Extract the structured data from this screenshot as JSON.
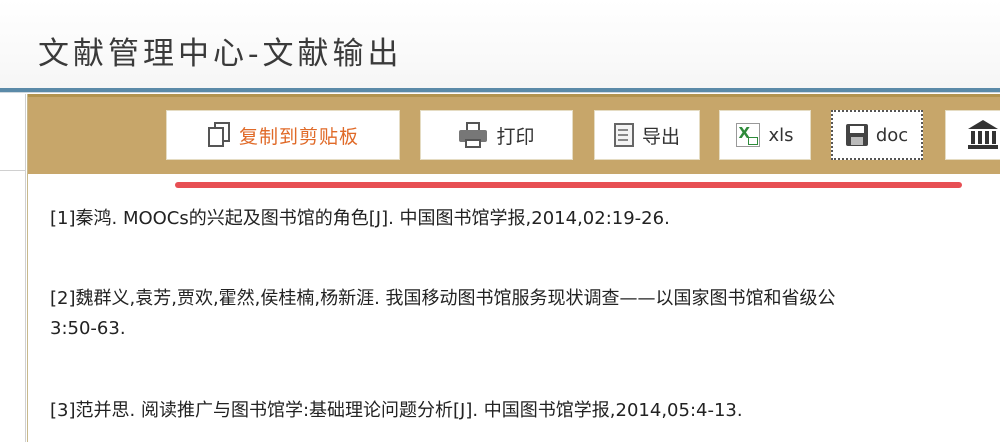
{
  "header": {
    "title": "文献管理中心-文献输出"
  },
  "toolbar": {
    "copy_label": "复制到剪贴板",
    "print_label": "打印",
    "export_label": "导出",
    "xls_label": "xls",
    "doc_label": "doc"
  },
  "icons": {
    "copy": "copy-icon",
    "print": "printer-icon",
    "export": "document-icon",
    "xls": "excel-icon",
    "doc": "save-icon",
    "library": "library-icon"
  },
  "colors": {
    "toolbar_bg": "#c7a66a",
    "header_rule": "#5b8aa8",
    "highlight_line": "#e74f54",
    "copy_text": "#e06a28"
  },
  "references": [
    {
      "line1": "[1]秦鸿. MOOCs的兴起及图书馆的角色[J]. 中国图书馆学报,2014,02:19-26."
    },
    {
      "line1": "[2]魏群义,袁芳,贾欢,霍然,侯桂楠,杨新涯. 我国移动图书馆服务现状调查——以国家图书馆和省级公",
      "line2": "3:50-63."
    },
    {
      "line1": "[3]范并思. 阅读推广与图书馆学:基础理论问题分析[J]. 中国图书馆学报,2014,05:4-13."
    }
  ]
}
